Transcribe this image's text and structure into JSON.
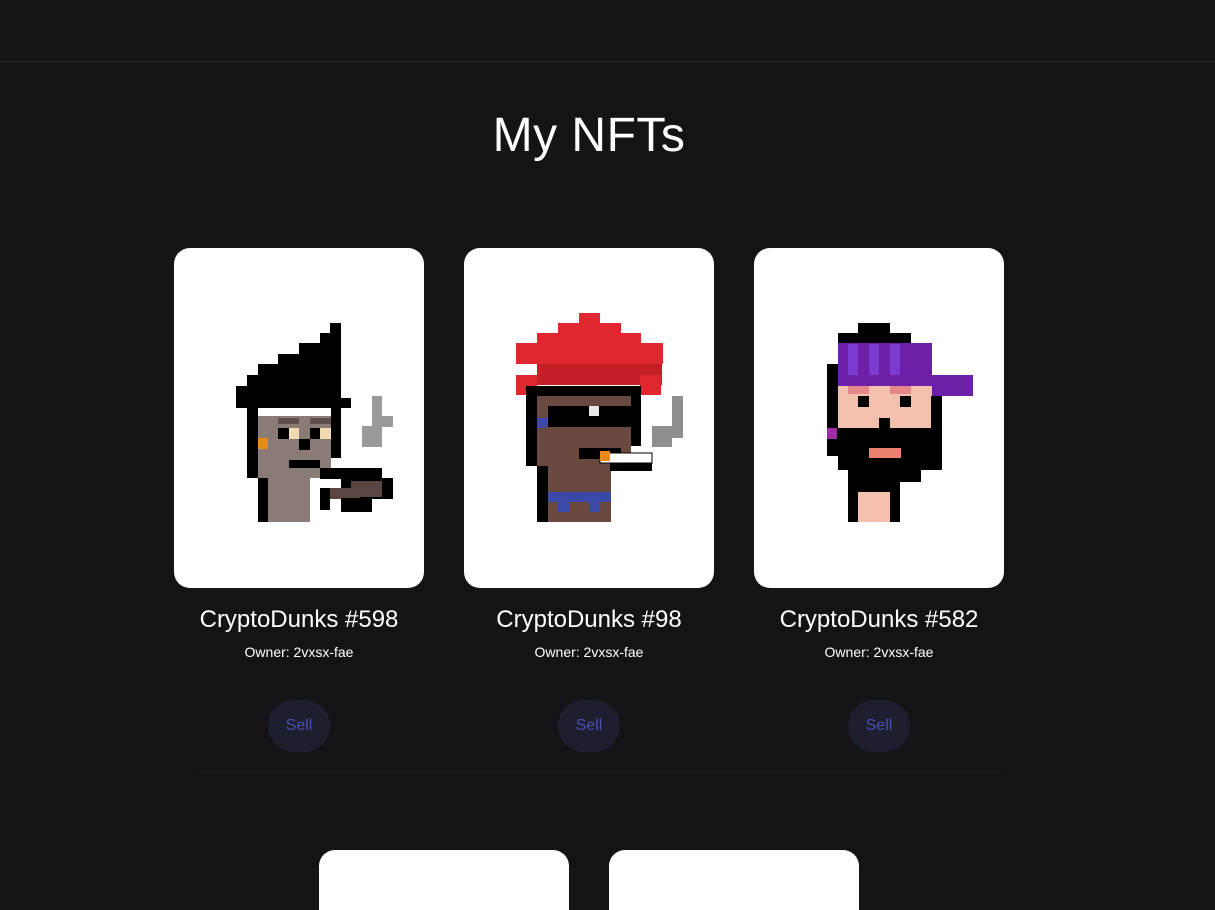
{
  "page": {
    "title": "My NFTs"
  },
  "nfts": [
    {
      "name": "CryptoDunks #598",
      "owner": "Owner: 2vxsx-fae",
      "sell_label": "Sell",
      "image_icon": "pixel-punk-avatar"
    },
    {
      "name": "CryptoDunks #98",
      "owner": "Owner: 2vxsx-fae",
      "sell_label": "Sell",
      "image_icon": "pixel-punk-avatar"
    },
    {
      "name": "CryptoDunks #582",
      "owner": "Owner: 2vxsx-fae",
      "sell_label": "Sell",
      "image_icon": "pixel-punk-avatar"
    }
  ],
  "colors": {
    "background": "#141416",
    "card": "#ffffff",
    "sell_button_bg": "#1d1f2e",
    "sell_button_text": "#4b4fb8"
  }
}
